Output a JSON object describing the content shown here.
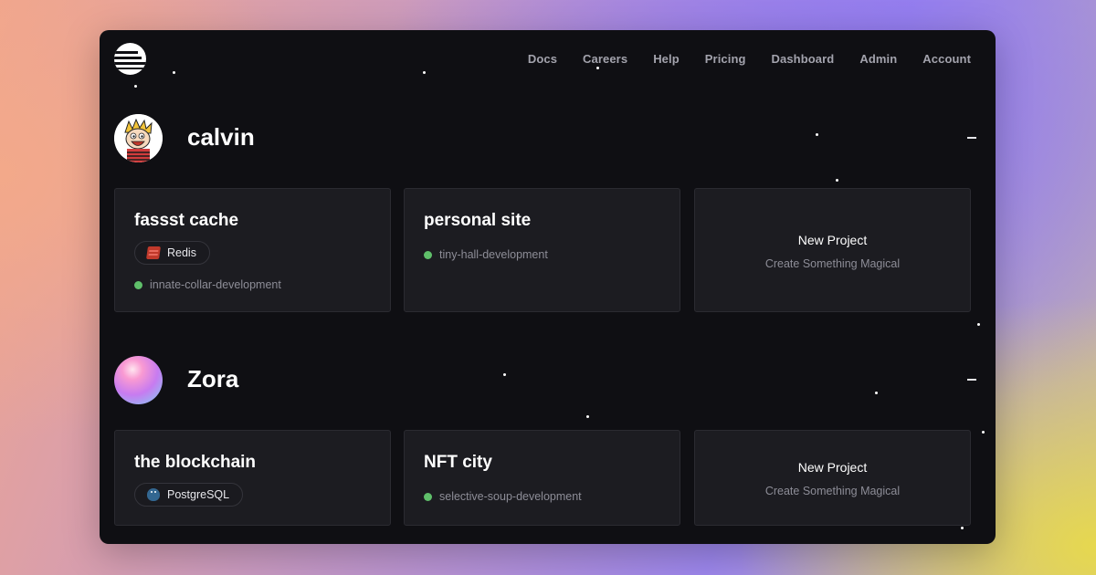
{
  "nav": {
    "items": [
      "Docs",
      "Careers",
      "Help",
      "Pricing",
      "Dashboard",
      "Admin",
      "Account"
    ]
  },
  "teams": [
    {
      "name": "calvin",
      "projects": [
        {
          "title": "fassst cache",
          "service": "Redis",
          "environment": "innate-collar-development"
        },
        {
          "title": "personal site",
          "environment": "tiny-hall-development"
        }
      ],
      "new_project": {
        "title": "New Project",
        "subtitle": "Create Something Magical"
      }
    },
    {
      "name": "Zora",
      "projects": [
        {
          "title": "the blockchain",
          "service": "PostgreSQL"
        },
        {
          "title": "NFT city",
          "environment": "selective-soup-development"
        }
      ],
      "new_project": {
        "title": "New Project",
        "subtitle": "Create Something Magical"
      }
    }
  ],
  "colors": {
    "window_bg": "#0f0f13",
    "card_bg": "#1c1c21",
    "status_dot": "#5fbf6a",
    "text_primary": "#ffffff",
    "text_muted": "#8d8d97"
  },
  "icons": {
    "logo": "railway-logo-icon",
    "collapse": "minus-icon",
    "redis": "redis-icon",
    "postgres": "postgresql-icon"
  }
}
